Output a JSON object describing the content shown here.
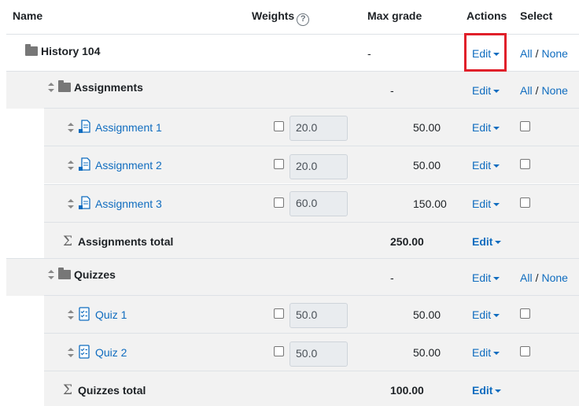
{
  "header": {
    "name": "Name",
    "weights": "Weights",
    "weights_help": "?",
    "max_grade": "Max grade",
    "actions": "Actions",
    "select": "Select"
  },
  "course": {
    "name": "History 104",
    "max_grade": "-",
    "edit": "Edit",
    "select_all": "All",
    "select_sep": "/",
    "select_none": "None"
  },
  "assignments": {
    "name": "Assignments",
    "max_grade": "-",
    "edit": "Edit",
    "select_all": "All",
    "select_sep": "/",
    "select_none": "None",
    "items": [
      {
        "name": "Assignment 1",
        "weight": "20.0",
        "max_grade": "50.00",
        "edit": "Edit"
      },
      {
        "name": "Assignment 2",
        "weight": "20.0",
        "max_grade": "50.00",
        "edit": "Edit"
      },
      {
        "name": "Assignment 3",
        "weight": "60.0",
        "max_grade": "150.00",
        "edit": "Edit"
      }
    ],
    "total": {
      "name": "Assignments total",
      "max_grade": "250.00",
      "edit": "Edit"
    }
  },
  "quizzes": {
    "name": "Quizzes",
    "max_grade": "-",
    "edit": "Edit",
    "select_all": "All",
    "select_sep": "/",
    "select_none": "None",
    "items": [
      {
        "name": "Quiz 1",
        "weight": "50.0",
        "max_grade": "50.00",
        "edit": "Edit"
      },
      {
        "name": "Quiz 2",
        "weight": "50.0",
        "max_grade": "50.00",
        "edit": "Edit"
      }
    ],
    "total": {
      "name": "Quizzes total",
      "max_grade": "100.00",
      "edit": "Edit"
    }
  },
  "icons": {
    "folder": "folder-icon",
    "move": "move-icon",
    "assignment": "assignment-icon",
    "quiz": "quiz-icon",
    "sum": "sigma-icon"
  },
  "colors": {
    "link": "#0f6cbf",
    "highlight": "#e0202a",
    "row_bg": "#f2f2f2"
  }
}
